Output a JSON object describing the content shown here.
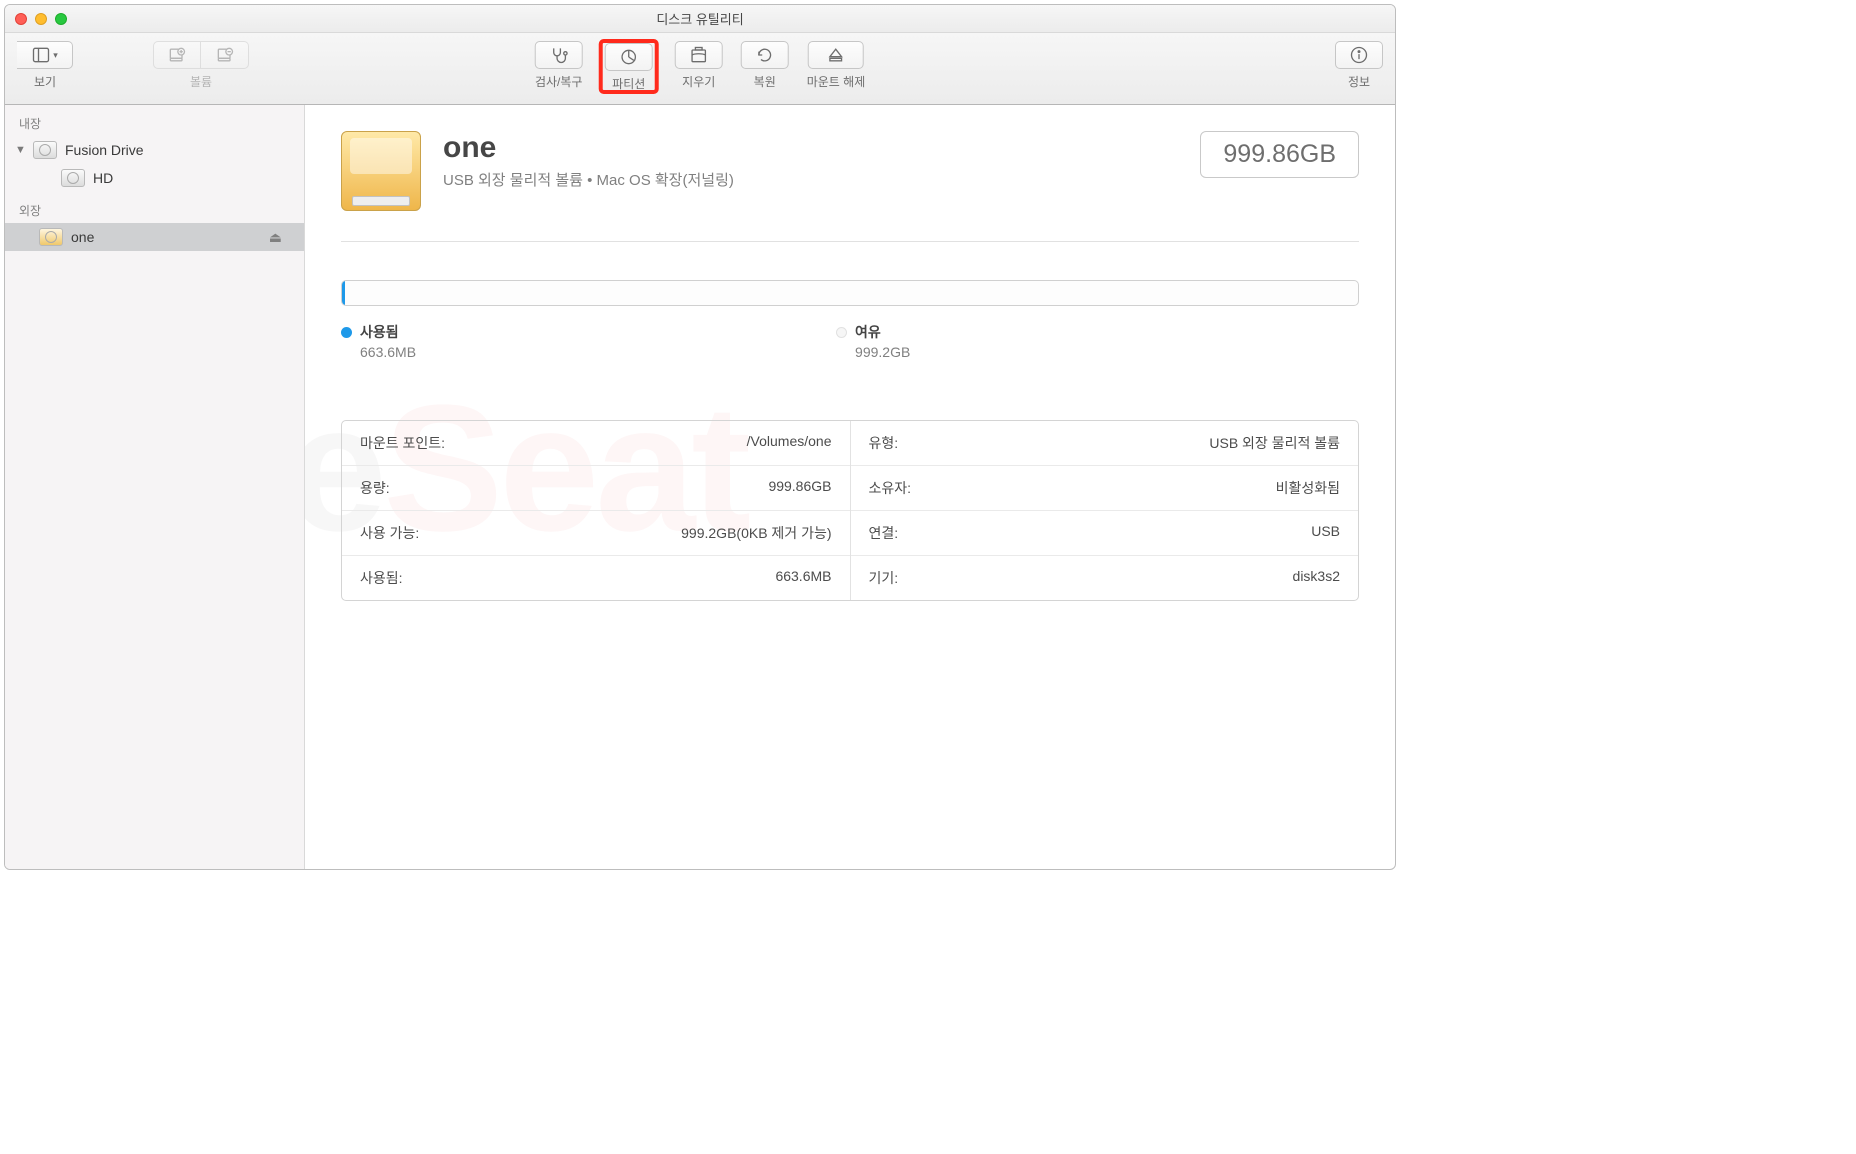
{
  "window": {
    "title": "디스크 유틸리티"
  },
  "toolbar": {
    "view": "보기",
    "volume": "볼륨",
    "firstaid": "검사/복구",
    "partition": "파티션",
    "erase": "지우기",
    "restore": "복원",
    "unmount": "마운트 해제",
    "info": "정보"
  },
  "sidebar": {
    "internal_header": "내장",
    "external_header": "외장",
    "items": {
      "fusion": "Fusion Drive",
      "hd": "HD",
      "one": "one"
    }
  },
  "hero": {
    "name": "one",
    "subtitle": "USB 외장 물리적 볼륨 • Mac OS 확장(저널링)",
    "size": "999.86GB"
  },
  "usage": {
    "used_label": "사용됨",
    "used_value": "663.6MB",
    "free_label": "여유",
    "free_value": "999.2GB"
  },
  "info": {
    "left": [
      {
        "k": "마운트 포인트:",
        "v": "/Volumes/one"
      },
      {
        "k": "용량:",
        "v": "999.86GB"
      },
      {
        "k": "사용 가능:",
        "v": "999.2GB(0KB 제거 가능)"
      },
      {
        "k": "사용됨:",
        "v": "663.6MB"
      }
    ],
    "right": [
      {
        "k": "유형:",
        "v": "USB 외장 물리적 볼륨"
      },
      {
        "k": "소유자:",
        "v": "비활성화됨"
      },
      {
        "k": "연결:",
        "v": "USB"
      },
      {
        "k": "기기:",
        "v": "disk3s2"
      }
    ]
  },
  "watermark": "OneSeat"
}
